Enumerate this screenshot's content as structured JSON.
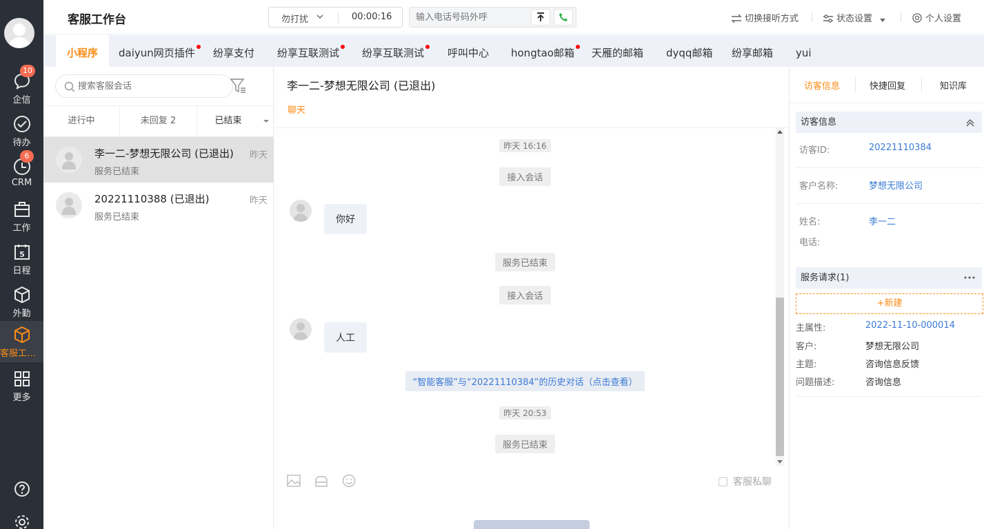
{
  "nav": {
    "items": [
      {
        "label": "企信",
        "badge": "10"
      },
      {
        "label": "待办",
        "badge": ""
      },
      {
        "label": "CRM",
        "badge": "6"
      },
      {
        "label": "工作",
        "badge": ""
      },
      {
        "label": "日程",
        "badge": ""
      },
      {
        "label": "外勤",
        "badge": ""
      },
      {
        "label": "客服工作台",
        "badge": ""
      },
      {
        "label": "更多",
        "badge": ""
      }
    ],
    "calendar_day": "5",
    "accent_color": "#fa8c16"
  },
  "header": {
    "title": "客服工作台",
    "status": "勿打扰",
    "timer": "00:00:16",
    "dial_placeholder": "输入电话号码外呼",
    "switch_mode": "切换接听方式",
    "status_settings": "状态设置",
    "personal_settings": "个人设置"
  },
  "channel_tabs": [
    {
      "label": "小程序",
      "dot": false,
      "active": true
    },
    {
      "label": "daiyun网页插件",
      "dot": true
    },
    {
      "label": "纷享支付",
      "dot": false
    },
    {
      "label": "纷享互联测试",
      "dot": true
    },
    {
      "label": "纷享互联测试",
      "dot": true
    },
    {
      "label": "呼叫中心",
      "dot": false
    },
    {
      "label": "hongtao邮箱",
      "dot": true
    },
    {
      "label": "天雁的邮箱",
      "dot": false
    },
    {
      "label": "dyqq邮箱",
      "dot": false
    },
    {
      "label": "纷享邮箱",
      "dot": false
    },
    {
      "label": "yui",
      "dot": false
    }
  ],
  "session_list": {
    "search_placeholder": "搜索客服会话",
    "subtabs": [
      "进行中",
      "未回复 2",
      "已结束"
    ],
    "sessions": [
      {
        "name": "李一二-梦想无限公司 (已退出)",
        "status": "服务已结束",
        "time": "昨天"
      },
      {
        "name": "20221110388 (已退出)",
        "status": "服务已结束",
        "time": "昨天"
      }
    ]
  },
  "chat": {
    "title": "李一二-梦想无限公司 (已退出)",
    "subtab": "聊天",
    "messages": {
      "time1": "昨天 16:16",
      "join1": "接入会话",
      "msg1": "你好",
      "ended1": "服务已结束",
      "join2": "接入会话",
      "msg2": "人工",
      "history_link": "“智能客服”与“20221110384”的历史对话（点击查看）",
      "time2": "昨天 20:53",
      "ended2": "服务已结束"
    },
    "private_chat": "客服私聊"
  },
  "right_panel": {
    "tabs": [
      "访客信息",
      "快捷回复",
      "知识库"
    ],
    "visitor_section": "访客信息",
    "visitor_id_label": "访客ID:",
    "visitor_id": "20221110384",
    "customer_name_label": "客户名称:",
    "customer_name": "梦想无限公司",
    "name_label": "姓名:",
    "name": "李一二",
    "phone_label": "电话:",
    "service_section": "服务请求(1)",
    "new_button": "+新建",
    "request": {
      "main_attr_label": "主属性:",
      "main_attr": "2022-11-10-000014",
      "customer_label": "客户:",
      "customer": "梦想无限公司",
      "subject_label": "主题:",
      "subject": "咨询信息反馈",
      "desc_label": "问题描述:",
      "desc": "咨询信息"
    }
  }
}
